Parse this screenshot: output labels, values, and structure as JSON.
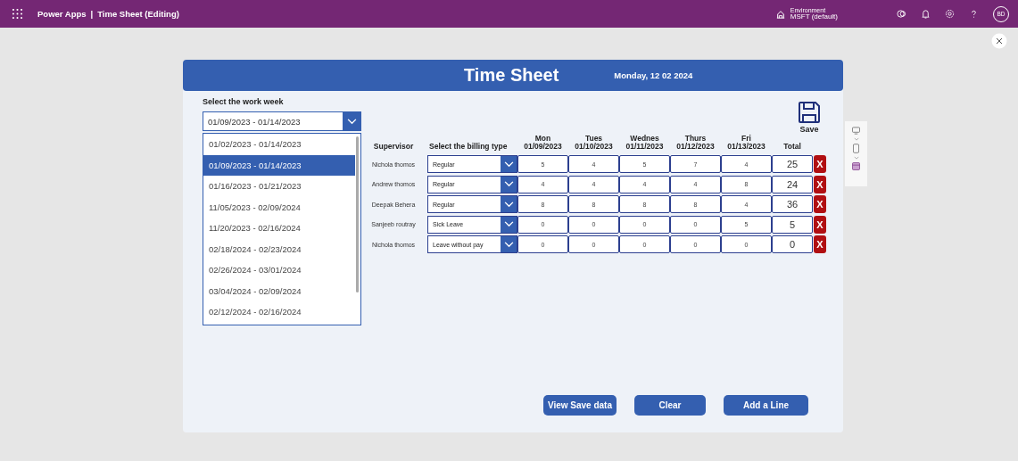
{
  "topbar": {
    "app": "Power Apps",
    "separator": "|",
    "document": "Time Sheet (Editing)",
    "environment_label": "Environment",
    "environment": "MSFT (default)",
    "avatar": "BD"
  },
  "header": {
    "title": "Time Sheet",
    "date": "Monday, 12 02 2024"
  },
  "week_selector": {
    "label": "Select the work week",
    "value": "01/09/2023 - 01/14/2023",
    "expanded": true,
    "options": [
      {
        "label": "01/02/2023 - 01/14/2023",
        "selected": false
      },
      {
        "label": "01/09/2023 - 01/14/2023",
        "selected": true
      },
      {
        "label": "01/16/2023 - 01/21/2023",
        "selected": false
      },
      {
        "label": "11/05/2023 - 02/09/2024",
        "selected": false
      },
      {
        "label": "11/20/2023 - 02/16/2024",
        "selected": false
      },
      {
        "label": "02/18/2024 - 02/23/2024",
        "selected": false
      },
      {
        "label": "02/26/2024 - 03/01/2024",
        "selected": false
      },
      {
        "label": "03/04/2024 - 02/09/2024",
        "selected": false
      },
      {
        "label": "02/12/2024 - 02/16/2024",
        "selected": false
      }
    ]
  },
  "save_button": {
    "label": "Save"
  },
  "table": {
    "columns": [
      {
        "label": "Supervisor"
      },
      {
        "label": "Select the billing type"
      },
      {
        "label": "Mon",
        "date": "01/09/2023"
      },
      {
        "label": "Tues",
        "date": "01/10/2023"
      },
      {
        "label": "Wednes",
        "date": "01/11/2023"
      },
      {
        "label": "Thurs",
        "date": "01/12/2023"
      },
      {
        "label": "Fri",
        "date": "01/13/2023"
      },
      {
        "label": "Total"
      }
    ],
    "rows": [
      {
        "supervisor": "Nichola thomos",
        "billing": "Regular",
        "days": [
          "5",
          "4",
          "5",
          "7",
          "4"
        ],
        "total": "25",
        "delete": "X"
      },
      {
        "supervisor": "Andrew thomos",
        "billing": "Regular",
        "days": [
          "4",
          "4",
          "4",
          "4",
          "8"
        ],
        "total": "24",
        "delete": "X"
      },
      {
        "supervisor": "Deepak Behera",
        "billing": "Regular",
        "days": [
          "8",
          "8",
          "8",
          "8",
          "4"
        ],
        "total": "36",
        "delete": "X"
      },
      {
        "supervisor": "Sanjeeb routray",
        "billing": "Sick Leave",
        "days": [
          "0",
          "0",
          "0",
          "0",
          "5"
        ],
        "total": "5",
        "delete": "X"
      },
      {
        "supervisor": "Nichola thomos",
        "billing": "Leave without pay",
        "days": [
          "0",
          "0",
          "0",
          "0",
          "0"
        ],
        "total": "0",
        "delete": "X"
      }
    ]
  },
  "buttons": [
    {
      "label": "View Save data"
    },
    {
      "label": "Clear"
    },
    {
      "label": "Add a Line"
    }
  ]
}
